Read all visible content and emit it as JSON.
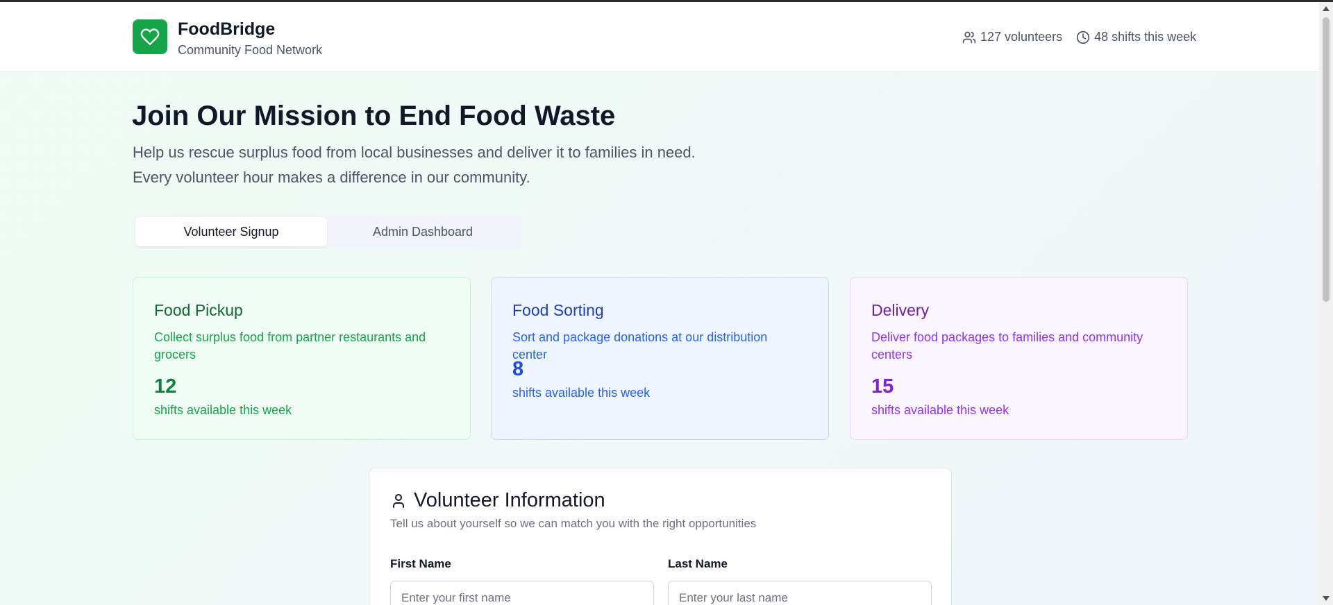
{
  "header": {
    "brand": "FoodBridge",
    "subtitle": "Community Food Network",
    "icon": "heart-icon",
    "stats": {
      "volunteers": "127 volunteers",
      "shifts": "48 shifts this week"
    }
  },
  "hero": {
    "title": "Join Our Mission to End Food Waste",
    "line1": "Help us rescue surplus food from local businesses and deliver it to families in need.",
    "line2": "Every volunteer hour makes a difference in our community."
  },
  "tabs": [
    {
      "label": "Volunteer Signup",
      "active": true
    },
    {
      "label": "Admin Dashboard",
      "active": false
    }
  ],
  "cards": [
    {
      "title": "Food Pickup",
      "description": "Collect surplus food from partner restaurants and grocers",
      "count": "12",
      "footer": "shifts available this week",
      "color": "#16a34a"
    },
    {
      "title": "Food Sorting",
      "description": "Sort and package donations at our distribution center",
      "count": "8",
      "footer": "shifts available this week",
      "color": "#2563eb"
    },
    {
      "title": "Delivery",
      "description": "Deliver food packages to families and community centers",
      "count": "15",
      "footer": "shifts available this week",
      "color": "#9333ea"
    }
  ],
  "form": {
    "title": "Volunteer Information",
    "subtitle": "Tell us about yourself so we can match you with the right opportunities",
    "first_name": {
      "label": "First Name",
      "placeholder": "Enter your first name",
      "value": ""
    },
    "last_name": {
      "label": "Last Name",
      "placeholder": "Enter your last name",
      "value": ""
    }
  },
  "colors": {
    "brand": "#16a34a",
    "text": "#111827",
    "muted": "#4b5563"
  }
}
